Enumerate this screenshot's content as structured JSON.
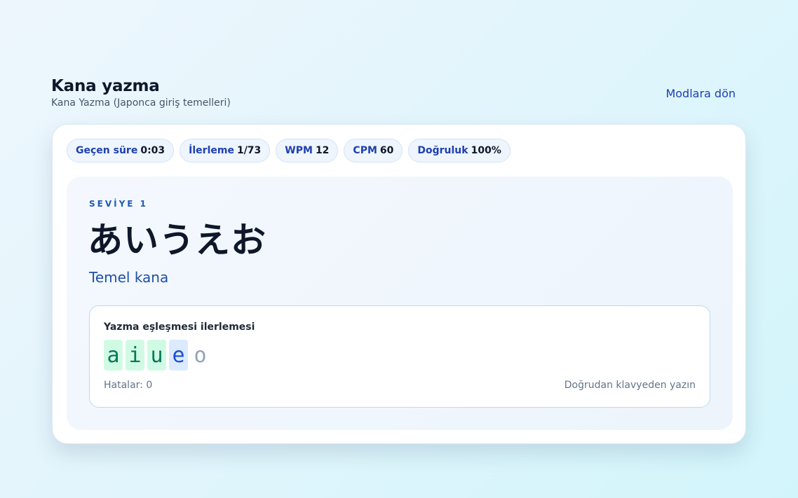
{
  "header": {
    "title": "Kana yazma",
    "subtitle": "Kana Yazma (Japonca giriş temelleri)",
    "back_label": "Modlara dön"
  },
  "stats": [
    {
      "label": "Geçen süre",
      "value": "0:03"
    },
    {
      "label": "İlerleme",
      "value": "1/73"
    },
    {
      "label": "WPM",
      "value": "12"
    },
    {
      "label": "CPM",
      "value": "60"
    },
    {
      "label": "Doğruluk",
      "value": "100%"
    }
  ],
  "lesson": {
    "level": "SEVİYE 1",
    "kana": "あいうえお",
    "description": "Temel kana"
  },
  "progress": {
    "title": "Yazma eşleşmesi ilerlemesi",
    "letters": [
      {
        "char": "a",
        "state": "done"
      },
      {
        "char": "i",
        "state": "done"
      },
      {
        "char": "u",
        "state": "done"
      },
      {
        "char": "e",
        "state": "current"
      },
      {
        "char": "o",
        "state": "pending"
      }
    ],
    "errors": "Hatalar: 0",
    "hint": "Doğrudan klavyeden yazın"
  },
  "colors": {
    "accent": "#1e40af",
    "done_bg": "#d1fae5",
    "current_bg": "#dbeafe"
  }
}
